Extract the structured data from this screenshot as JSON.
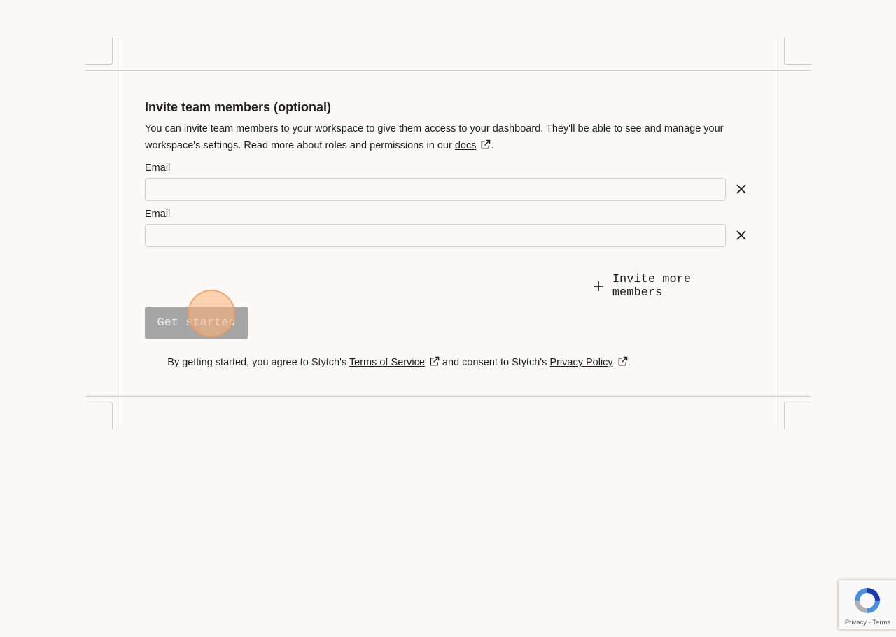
{
  "invite": {
    "title": "Invite team members (optional)",
    "description_before_link": "You can invite team members to your workspace to give them access to your dashboard. They'll be able to see and manage your workspace's settings. Read more about roles and permissions in our ",
    "docs_link": "docs",
    "description_after_link": ".",
    "fields": [
      {
        "label": "Email",
        "value": "",
        "placeholder": ""
      },
      {
        "label": "Email",
        "value": "",
        "placeholder": ""
      }
    ],
    "invite_more_label": "Invite more members",
    "submit_label": "Get started"
  },
  "terms": {
    "prefix": "By getting started, you agree to Stytch's ",
    "tos_link": "Terms of Service",
    "middle": " and consent to Stytch's ",
    "privacy_link": "Privacy Policy",
    "suffix": "."
  },
  "recaptcha": {
    "privacy": "Privacy",
    "separator": " - ",
    "terms": "Terms"
  },
  "icons": {
    "external_link": "external-link-icon",
    "remove": "close-icon",
    "add": "plus-icon",
    "recaptcha": "recaptcha-logo-icon"
  },
  "colors": {
    "background": "#faf9f7",
    "text": "#1e1e1e",
    "button_disabled": "#a6a6a6",
    "frame_lines": "#c9c9c9",
    "click_indicator": "#ffb278"
  }
}
